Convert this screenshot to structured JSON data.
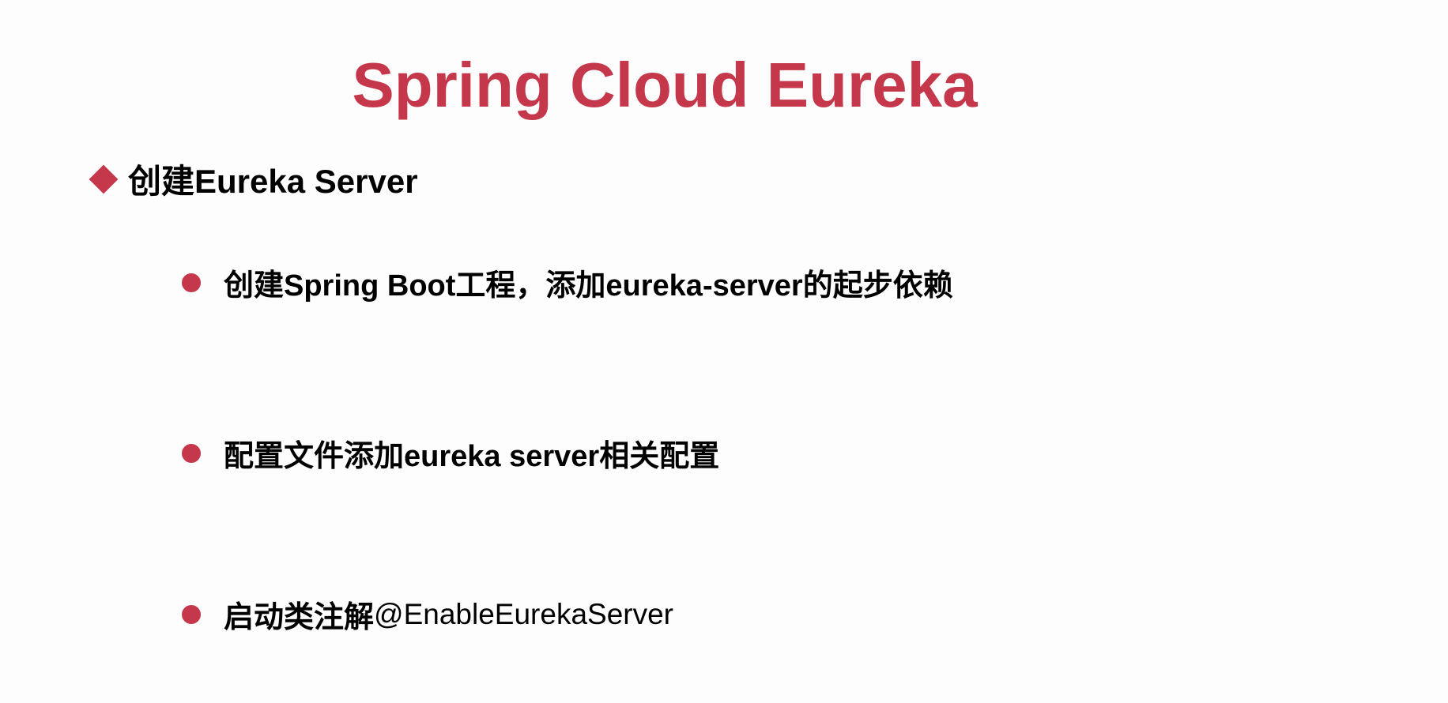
{
  "slide": {
    "title": "Spring Cloud Eureka",
    "heading": "创建Eureka Server",
    "items": [
      {
        "text": "创建Spring Boot工程，添加eureka-server的起步依赖",
        "code": ""
      },
      {
        "text": "配置文件添加eureka server相关配置",
        "code": ""
      },
      {
        "text": "启动类注解",
        "code": "@EnableEurekaServer"
      }
    ]
  },
  "colors": {
    "accent": "#c5384b",
    "text": "#000000",
    "background": "#fdfdfd"
  },
  "icons": {
    "heading_marker": "diamond-icon",
    "item_marker": "bullet-dot-icon"
  }
}
